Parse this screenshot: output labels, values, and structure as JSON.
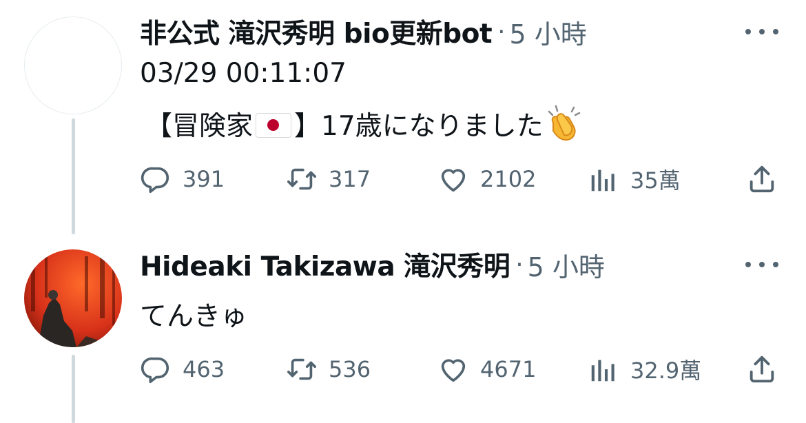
{
  "tweets": [
    {
      "author_name": "非公式 滝沢秀明 bio更新bot",
      "separator": "·",
      "time": "5 小時",
      "body_line1": "03/29 00:11:07",
      "body_line2_pre": "【冒険家",
      "body_line2_post": "】17歳になりました",
      "emoji_icon": "clapping-hands-icon",
      "flag_icon": "japan-flag-icon",
      "replies": "391",
      "retweets": "317",
      "likes": "2102",
      "views": "35萬"
    },
    {
      "author_name": "Hideaki Takizawa 滝沢秀明",
      "separator": "·",
      "time": "5 小時",
      "body_line1": "てんきゅ",
      "replies": "463",
      "retweets": "536",
      "likes": "4671",
      "views": "32.9萬"
    }
  ],
  "colors": {
    "text": "#0f1419",
    "muted": "#536471",
    "thread_line": "#cfd9de",
    "flag_red": "#bc002d"
  }
}
